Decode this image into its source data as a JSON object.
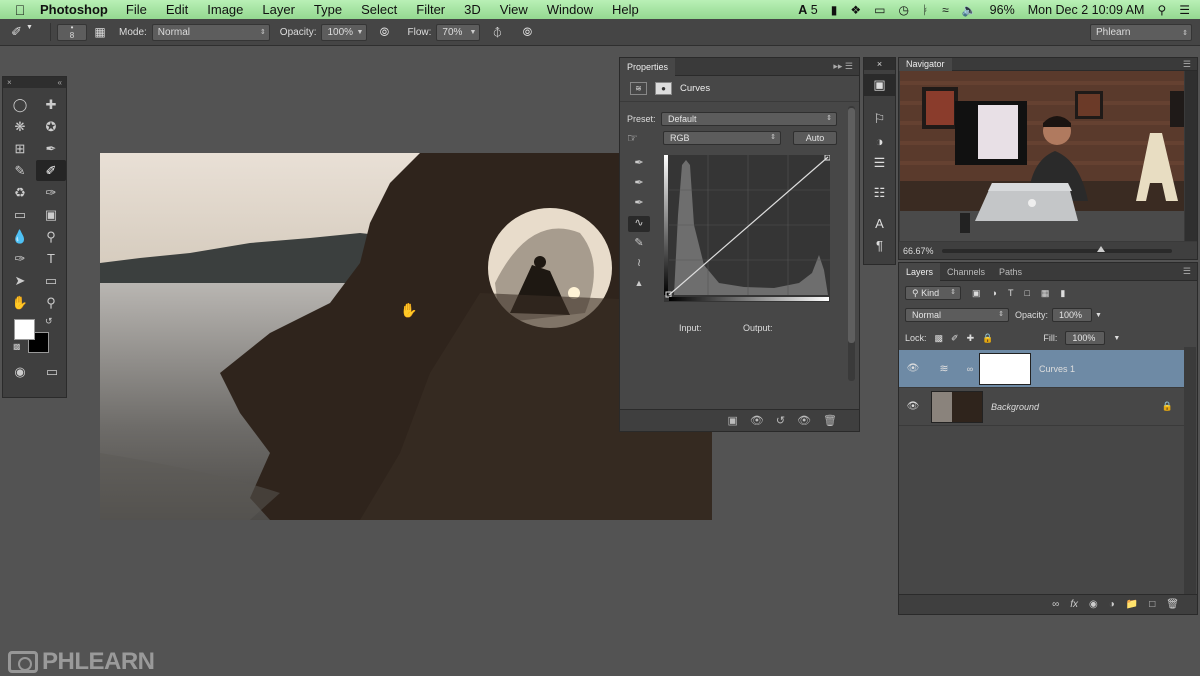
{
  "menubar": {
    "app_name": "Photoshop",
    "items": [
      "File",
      "Edit",
      "Image",
      "Layer",
      "Type",
      "Select",
      "Filter",
      "3D",
      "View",
      "Window",
      "Help"
    ],
    "adobe_badge": "5",
    "battery": "96%",
    "datetime": "Mon Dec 2  10:09 AM"
  },
  "options_bar": {
    "brush_size": "8",
    "mode_label": "Mode:",
    "mode_value": "Normal",
    "opacity_label": "Opacity:",
    "opacity_value": "100%",
    "flow_label": "Flow:",
    "flow_value": "70%",
    "workspace": "Phlearn"
  },
  "properties": {
    "tab": "Properties",
    "title": "Curves",
    "preset_label": "Preset:",
    "preset_value": "Default",
    "channel_value": "RGB",
    "auto_label": "Auto",
    "input_label": "Input:",
    "output_label": "Output:"
  },
  "navigator": {
    "tab": "Navigator",
    "zoom": "66.67%"
  },
  "layers": {
    "tabs": [
      "Layers",
      "Channels",
      "Paths"
    ],
    "kind_label": "Kind",
    "blend_mode": "Normal",
    "opacity_label": "Opacity:",
    "opacity_value": "100%",
    "lock_label": "Lock:",
    "fill_label": "Fill:",
    "fill_value": "100%",
    "items": [
      {
        "name": "Curves 1",
        "selected": true
      },
      {
        "name": "Background",
        "selected": false
      }
    ]
  },
  "watermark": {
    "text": "PHLEARN"
  },
  "colors": {
    "menubar_bg": "#a8e6a4",
    "panel_bg": "#474747",
    "workspace_bg": "#535353",
    "selected_layer": "#6e8aa5"
  }
}
